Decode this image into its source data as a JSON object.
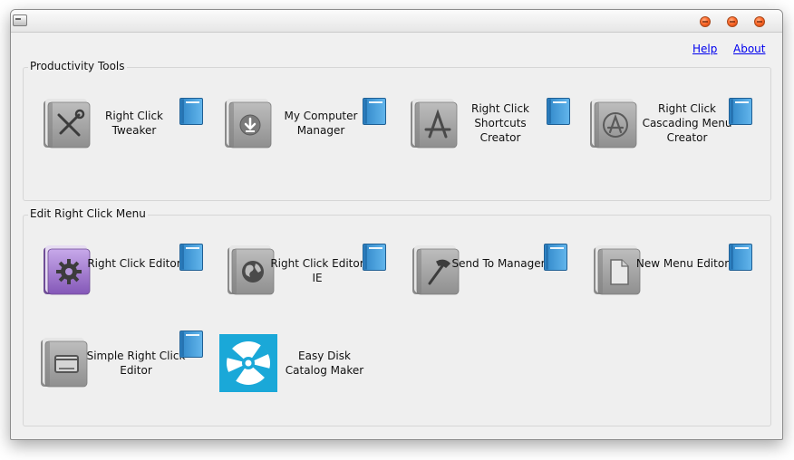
{
  "window": {
    "links": {
      "help": "Help",
      "about": "About"
    }
  },
  "groups": [
    {
      "title": "Productivity Tools",
      "tools": [
        {
          "label": "Right Click Tweaker",
          "icon": "tools-icon"
        },
        {
          "label": "My Computer Manager",
          "icon": "download-icon"
        },
        {
          "label": "Right Click Shortcuts Creator",
          "icon": "app-store-icon"
        },
        {
          "label": "Right Click Cascading Menu Creator",
          "icon": "app-store-circle-icon"
        }
      ]
    },
    {
      "title": "Edit Right Click Menu",
      "tools": [
        {
          "label": "Right Click Editor",
          "icon": "gear-icon"
        },
        {
          "label": "Right Click Editor IE",
          "icon": "globe-icon"
        },
        {
          "label": "Send To Manager",
          "icon": "hammer-icon"
        },
        {
          "label": "New Menu Editor",
          "icon": "document-icon"
        },
        {
          "label": "Simple Right Click Editor",
          "icon": "window-icon"
        },
        {
          "label": "Easy Disk Catalog Maker",
          "icon": "disc-icon"
        }
      ]
    }
  ],
  "colors": {
    "folder_gray": "#a8a8a8",
    "folder_purple": "#9b73c8",
    "book_blue": "#4aa3df",
    "disc_cyan": "#1aa8d8"
  }
}
